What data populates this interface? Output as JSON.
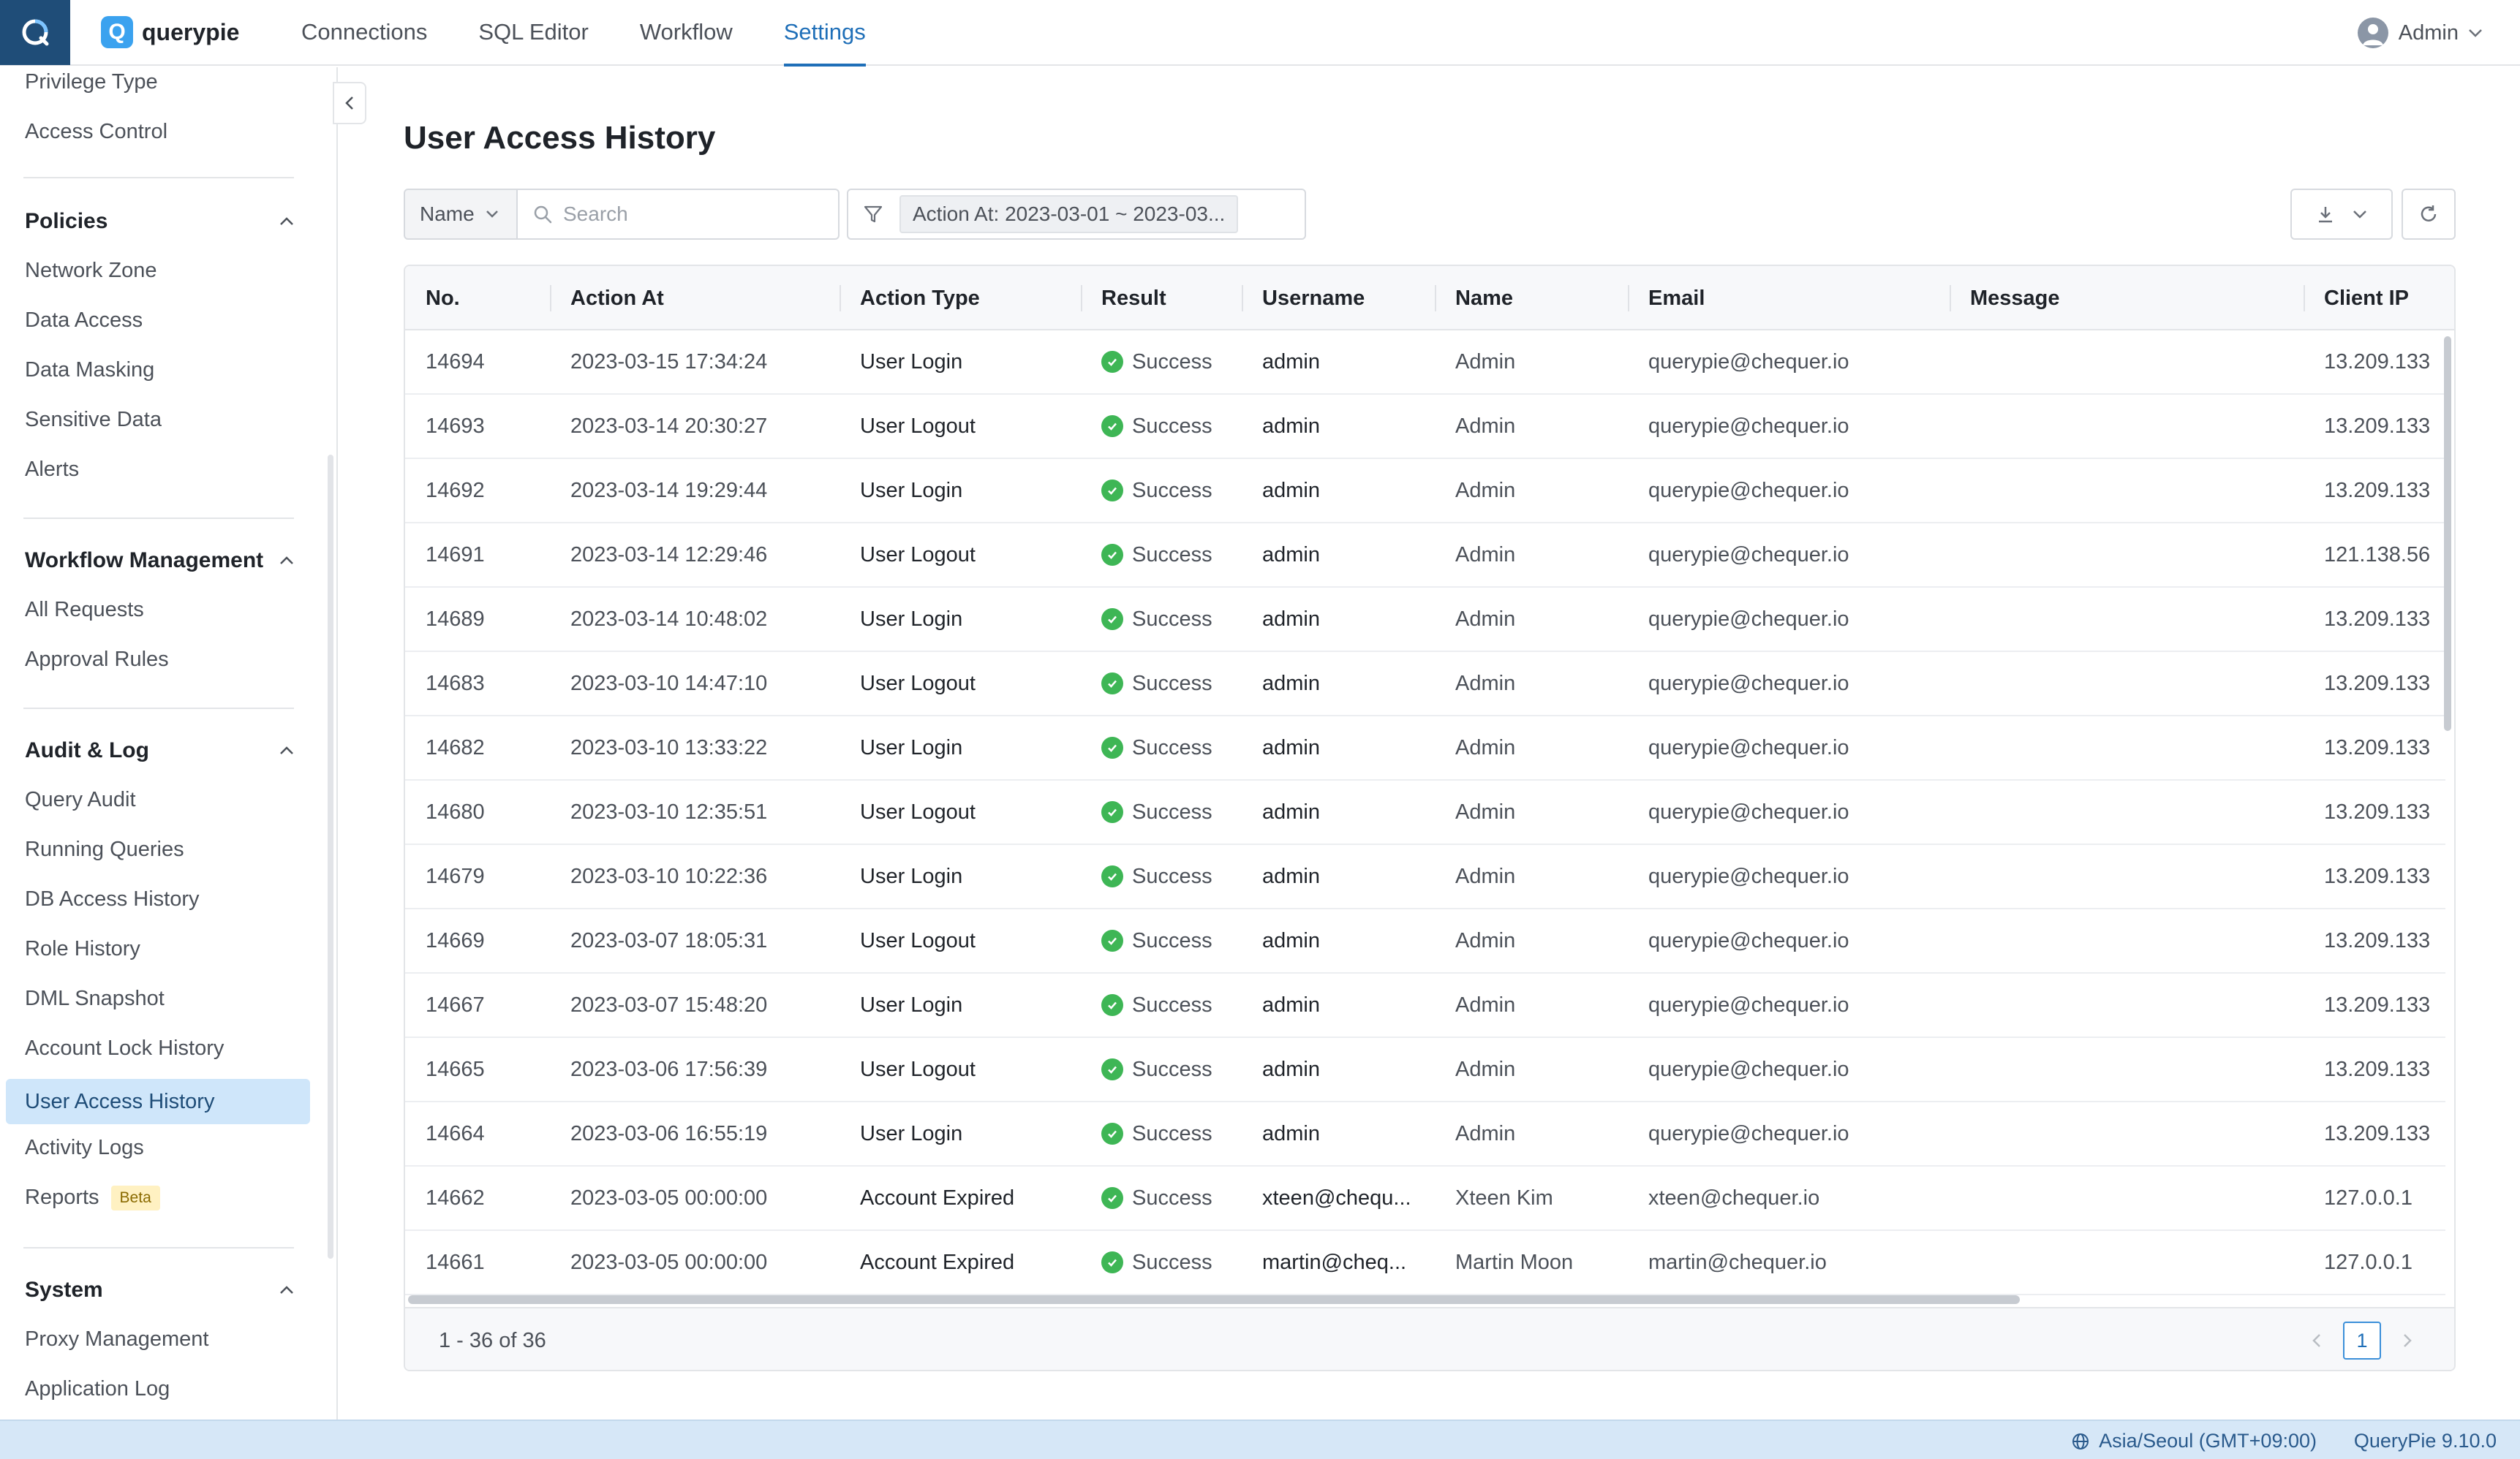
{
  "header": {
    "brand_letter": "Q",
    "brand_name": "querypie",
    "nav": [
      "Connections",
      "SQL Editor",
      "Workflow",
      "Settings"
    ],
    "active_nav": "Settings",
    "user": "Admin"
  },
  "sidebar": {
    "top_items": [
      "Privilege Type",
      "Access Control"
    ],
    "policies": {
      "title": "Policies",
      "items": [
        "Network Zone",
        "Data Access",
        "Data Masking",
        "Sensitive Data",
        "Alerts"
      ]
    },
    "workflow": {
      "title": "Workflow Management",
      "items": [
        "All Requests",
        "Approval Rules"
      ]
    },
    "audit": {
      "title": "Audit & Log",
      "items": [
        "Query Audit",
        "Running Queries",
        "DB Access History",
        "Role History",
        "DML Snapshot",
        "Account Lock History",
        "User Access History",
        "Activity Logs",
        "Reports"
      ],
      "active": "User Access History",
      "reports_badge": "Beta"
    },
    "system": {
      "title": "System",
      "items": [
        "Proxy Management",
        "Application Log"
      ]
    }
  },
  "page": {
    "title": "User Access History",
    "filter_select": "Name",
    "search_placeholder": "Search",
    "filter_chip": "Action At: 2023-03-01 ~ 2023-03..."
  },
  "table": {
    "columns": [
      "No.",
      "Action At",
      "Action Type",
      "Result",
      "Username",
      "Name",
      "Email",
      "Message",
      "Client IP"
    ],
    "rows": [
      {
        "no": "14694",
        "at": "2023-03-15 17:34:24",
        "type": "User Login",
        "result": "Success",
        "username": "admin",
        "name": "Admin",
        "email": "querypie@chequer.io",
        "message": "",
        "ip": "13.209.133"
      },
      {
        "no": "14693",
        "at": "2023-03-14 20:30:27",
        "type": "User Logout",
        "result": "Success",
        "username": "admin",
        "name": "Admin",
        "email": "querypie@chequer.io",
        "message": "",
        "ip": "13.209.133"
      },
      {
        "no": "14692",
        "at": "2023-03-14 19:29:44",
        "type": "User Login",
        "result": "Success",
        "username": "admin",
        "name": "Admin",
        "email": "querypie@chequer.io",
        "message": "",
        "ip": "13.209.133"
      },
      {
        "no": "14691",
        "at": "2023-03-14 12:29:46",
        "type": "User Logout",
        "result": "Success",
        "username": "admin",
        "name": "Admin",
        "email": "querypie@chequer.io",
        "message": "",
        "ip": "121.138.56"
      },
      {
        "no": "14689",
        "at": "2023-03-14 10:48:02",
        "type": "User Login",
        "result": "Success",
        "username": "admin",
        "name": "Admin",
        "email": "querypie@chequer.io",
        "message": "",
        "ip": "13.209.133"
      },
      {
        "no": "14683",
        "at": "2023-03-10 14:47:10",
        "type": "User Logout",
        "result": "Success",
        "username": "admin",
        "name": "Admin",
        "email": "querypie@chequer.io",
        "message": "",
        "ip": "13.209.133"
      },
      {
        "no": "14682",
        "at": "2023-03-10 13:33:22",
        "type": "User Login",
        "result": "Success",
        "username": "admin",
        "name": "Admin",
        "email": "querypie@chequer.io",
        "message": "",
        "ip": "13.209.133"
      },
      {
        "no": "14680",
        "at": "2023-03-10 12:35:51",
        "type": "User Logout",
        "result": "Success",
        "username": "admin",
        "name": "Admin",
        "email": "querypie@chequer.io",
        "message": "",
        "ip": "13.209.133"
      },
      {
        "no": "14679",
        "at": "2023-03-10 10:22:36",
        "type": "User Login",
        "result": "Success",
        "username": "admin",
        "name": "Admin",
        "email": "querypie@chequer.io",
        "message": "",
        "ip": "13.209.133"
      },
      {
        "no": "14669",
        "at": "2023-03-07 18:05:31",
        "type": "User Logout",
        "result": "Success",
        "username": "admin",
        "name": "Admin",
        "email": "querypie@chequer.io",
        "message": "",
        "ip": "13.209.133"
      },
      {
        "no": "14667",
        "at": "2023-03-07 15:48:20",
        "type": "User Login",
        "result": "Success",
        "username": "admin",
        "name": "Admin",
        "email": "querypie@chequer.io",
        "message": "",
        "ip": "13.209.133"
      },
      {
        "no": "14665",
        "at": "2023-03-06 17:56:39",
        "type": "User Logout",
        "result": "Success",
        "username": "admin",
        "name": "Admin",
        "email": "querypie@chequer.io",
        "message": "",
        "ip": "13.209.133"
      },
      {
        "no": "14664",
        "at": "2023-03-06 16:55:19",
        "type": "User Login",
        "result": "Success",
        "username": "admin",
        "name": "Admin",
        "email": "querypie@chequer.io",
        "message": "",
        "ip": "13.209.133"
      },
      {
        "no": "14662",
        "at": "2023-03-05 00:00:00",
        "type": "Account Expired",
        "result": "Success",
        "username": "xteen@chequ...",
        "name": "Xteen Kim",
        "email": "xteen@chequer.io",
        "message": "",
        "ip": "127.0.0.1"
      },
      {
        "no": "14661",
        "at": "2023-03-05 00:00:00",
        "type": "Account Expired",
        "result": "Success",
        "username": "martin@cheq...",
        "name": "Martin Moon",
        "email": "martin@chequer.io",
        "message": "",
        "ip": "127.0.0.1"
      }
    ]
  },
  "footer": {
    "range": "1 - 36 of 36",
    "page": "1"
  },
  "status": {
    "timezone": "Asia/Seoul (GMT+09:00)",
    "version": "QueryPie 9.10.0"
  },
  "colors": {
    "accent": "#1f6fb8",
    "active_bg": "#cfe6fa",
    "success": "#3eb655",
    "statusbar": "#d6e7f7"
  }
}
